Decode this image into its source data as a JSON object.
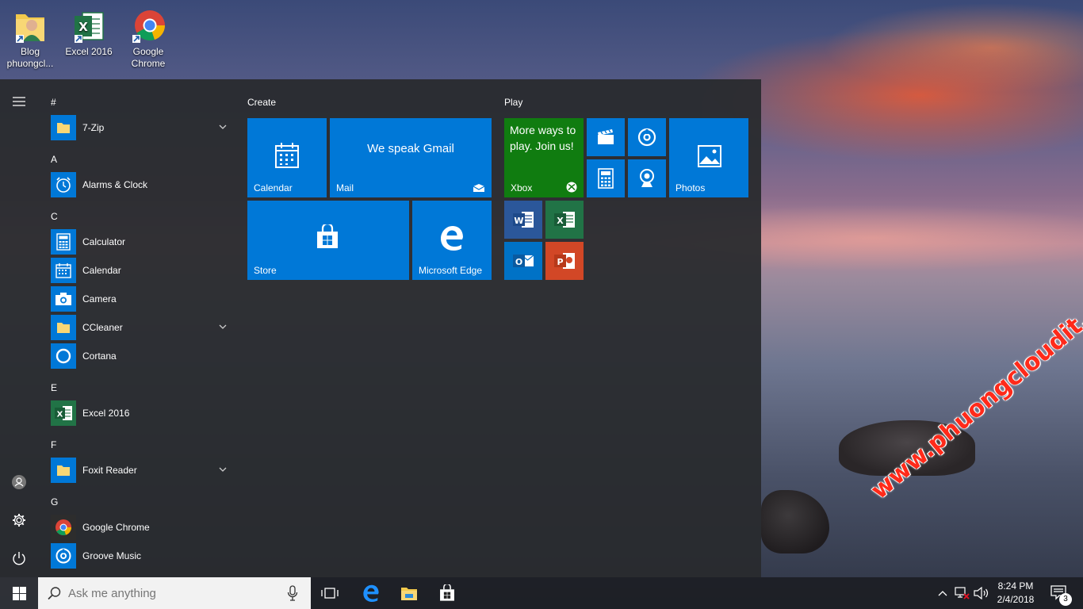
{
  "desktop": {
    "icons": [
      {
        "label": "Blog phuongcl..."
      },
      {
        "label": "Excel 2016"
      },
      {
        "label": "Google Chrome"
      }
    ],
    "watermark": "www.phuongcloudit.com"
  },
  "start_menu": {
    "app_list": {
      "groups": [
        {
          "letter": "#",
          "apps": [
            {
              "name": "7-Zip",
              "icon": "folder-icon",
              "expandable": true
            }
          ]
        },
        {
          "letter": "A",
          "apps": [
            {
              "name": "Alarms & Clock",
              "icon": "alarm-clock-icon"
            }
          ]
        },
        {
          "letter": "C",
          "apps": [
            {
              "name": "Calculator",
              "icon": "calculator-icon"
            },
            {
              "name": "Calendar",
              "icon": "calendar-icon"
            },
            {
              "name": "Camera",
              "icon": "camera-icon"
            },
            {
              "name": "CCleaner",
              "icon": "folder-icon",
              "expandable": true
            },
            {
              "name": "Cortana",
              "icon": "cortana-icon"
            }
          ]
        },
        {
          "letter": "E",
          "apps": [
            {
              "name": "Excel 2016",
              "icon": "excel-icon"
            }
          ]
        },
        {
          "letter": "F",
          "apps": [
            {
              "name": "Foxit Reader",
              "icon": "folder-icon",
              "expandable": true
            }
          ]
        },
        {
          "letter": "G",
          "apps": [
            {
              "name": "Google Chrome",
              "icon": "chrome-icon"
            },
            {
              "name": "Groove Music",
              "icon": "groove-music-icon"
            }
          ]
        }
      ]
    },
    "tiles": {
      "create_title": "Create",
      "play_title": "Play",
      "calendar": "Calendar",
      "mail": "Mail",
      "mail_headline": "We speak Gmail",
      "store": "Store",
      "edge": "Microsoft Edge",
      "xbox": "Xbox",
      "xbox_headline": "More ways to play. Join us!",
      "photos": "Photos"
    }
  },
  "taskbar": {
    "search_placeholder": "Ask me anything",
    "time": "8:24 PM",
    "date": "2/4/2018",
    "notification_count": "3"
  },
  "colors": {
    "accent": "#0078d7",
    "xbox_green": "#107c10",
    "word_blue": "#2b579a",
    "excel_green": "#217346",
    "outlook_blue": "#0072c6",
    "powerpoint_red": "#d24726"
  }
}
